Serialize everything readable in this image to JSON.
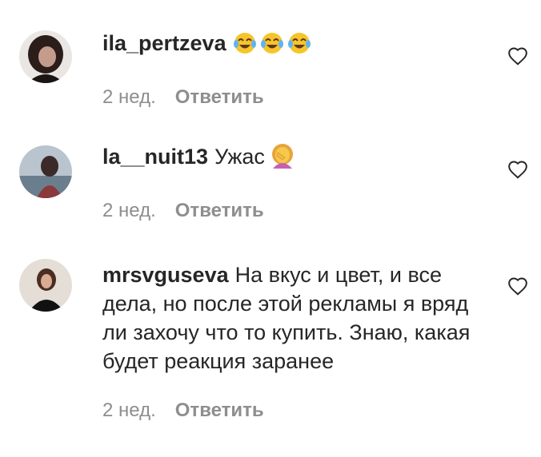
{
  "comments": [
    {
      "username": "ila_pertzeva",
      "text": "",
      "emojis": [
        "face-with-tears-of-joy-emoji",
        "face-with-tears-of-joy-emoji",
        "face-with-tears-of-joy-emoji"
      ],
      "time": "2 нед.",
      "reply_label": "Ответить",
      "like_icon": "heart-outline-icon"
    },
    {
      "username": "la__nuit13",
      "text": "Ужас",
      "emojis": [
        "woman-facepalming-emoji"
      ],
      "time": "2 нед.",
      "reply_label": "Ответить",
      "like_icon": "heart-outline-icon"
    },
    {
      "username": "mrsvguseva",
      "text": "На вкус и цвет, и все дела, но после этой рекламы я вряд ли захочу что то купить. Знаю, какая будет реакция заранее",
      "emojis": [],
      "time": "2 нед.",
      "reply_label": "Ответить",
      "like_icon": "heart-outline-icon"
    }
  ],
  "colors": {
    "text": "#262626",
    "secondary": "#8e8e8e",
    "background": "#ffffff"
  }
}
